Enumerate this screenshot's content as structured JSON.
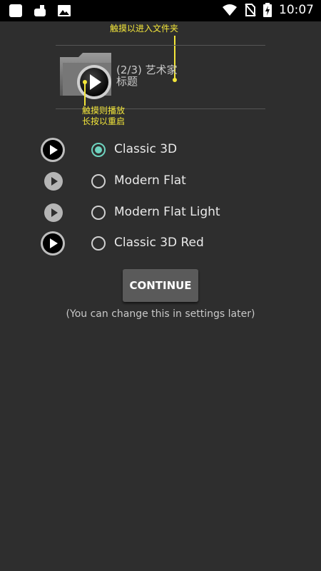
{
  "status_bar": {
    "time": "10:07",
    "left_icons": [
      "app-square-icon",
      "cloud-sync-icon",
      "image-icon"
    ],
    "right_icons": [
      "wifi-icon",
      "no-sim-icon",
      "battery-charging-icon"
    ]
  },
  "tutorial": {
    "touch_to_enter": "触摸以进入文件夹",
    "touch_to_play_line1": "触摸则播放",
    "touch_to_play_line2": "长按以重启"
  },
  "folder_card": {
    "title_line1": "(2/3) 艺术家",
    "title_line2": "标题"
  },
  "theme_options": [
    {
      "label": "Classic 3D",
      "selected": true,
      "icon": "play-3d-icon"
    },
    {
      "label": "Modern Flat",
      "selected": false,
      "icon": "play-flat-icon"
    },
    {
      "label": "Modern Flat Light",
      "selected": false,
      "icon": "play-flat-light-icon"
    },
    {
      "label": "Classic 3D Red",
      "selected": false,
      "icon": "play-3d-red-icon"
    }
  ],
  "continue_label": "CONTINUE",
  "settings_note": "(You can change this in settings later)",
  "colors": {
    "background": "#2e2e2e",
    "accent": "#6ed3bf",
    "tip_yellow": "#f3e63a",
    "button": "#5a5a5a"
  }
}
